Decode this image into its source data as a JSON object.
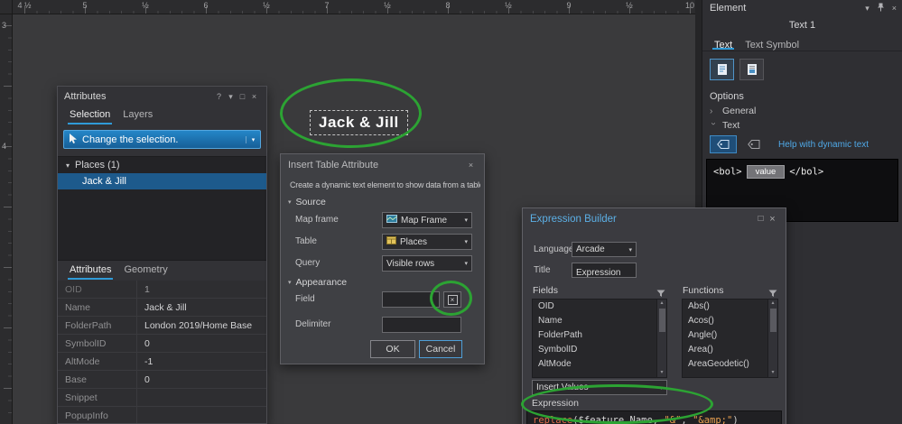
{
  "icons": {
    "close": "×",
    "dropdown": "▾",
    "help": "?",
    "float_window": "□",
    "maximize": "□",
    "chevron": "›",
    "scroll_up": "▴",
    "scroll_down": "▾",
    "tree_expander": "▾",
    "x_mark": "×",
    "section_chevron": "▾"
  },
  "rulers": {
    "horizontal": [
      "4 ½",
      "5",
      "½",
      "6",
      "½",
      "7",
      "½",
      "8",
      "½",
      "9",
      "½",
      "10"
    ],
    "vertical": [
      "3",
      "4"
    ]
  },
  "canvas": {
    "text_element": "Jack & Jill"
  },
  "attributes_panel": {
    "title": "Attributes",
    "tabs": {
      "selection": "Selection",
      "layers": "Layers"
    },
    "selection_button_label": "Change the selection.",
    "tree_parent": "Places (1)",
    "tree_child": "Jack & Jill",
    "bottom_tabs": {
      "attributes": "Attributes",
      "geometry": "Geometry"
    },
    "table_rows": [
      {
        "label": "OID",
        "value": "1"
      },
      {
        "label": "Name",
        "value": "Jack & Jill"
      },
      {
        "label": "FolderPath",
        "value": "London 2019/Home Base"
      },
      {
        "label": "SymbolID",
        "value": "0"
      },
      {
        "label": "AltMode",
        "value": "-1"
      },
      {
        "label": "Base",
        "value": "0"
      },
      {
        "label": "Snippet",
        "value": ""
      },
      {
        "label": "PopupInfo",
        "value": ""
      }
    ]
  },
  "insert_dialog": {
    "title": "Insert Table Attribute",
    "description": "Create a dynamic text element to show data from a table.",
    "source_section": "Source",
    "map_frame_label": "Map frame",
    "map_frame_value": "Map Frame",
    "table_label": "Table",
    "table_value": "Places",
    "query_label": "Query",
    "query_value": "Visible rows",
    "appearance_section": "Appearance",
    "field_label": "Field",
    "field_value": "",
    "delimiter_label": "Delimiter",
    "delimiter_value": "",
    "ok_label": "OK",
    "cancel_label": "Cancel"
  },
  "expression_builder": {
    "title": "Expression Builder",
    "language_label": "Language",
    "language_value": "Arcade",
    "title_label": "Title",
    "title_value": "Expression",
    "fields_header": "Fields",
    "functions_header": "Functions",
    "fields": [
      "OID",
      "Name",
      "FolderPath",
      "SymbolID",
      "AltMode"
    ],
    "functions": [
      "Abs()",
      "Acos()",
      "Angle()",
      "Area()",
      "AreaGeodetic()"
    ],
    "insert_values_label": "Insert Values",
    "expression_label": "Expression",
    "expression_tokens": [
      {
        "text": "replace",
        "type": "function"
      },
      {
        "text": "(",
        "type": "punctuation"
      },
      {
        "text": "$feature",
        "type": "variable"
      },
      {
        "text": ".Name",
        "type": "property"
      },
      {
        "text": ", ",
        "type": "punctuation"
      },
      {
        "text": "\"&\"",
        "type": "string"
      },
      {
        "text": ", ",
        "type": "punctuation"
      },
      {
        "text": "\"&amp;\"",
        "type": "string"
      },
      {
        "text": ")",
        "type": "punctuation"
      }
    ]
  },
  "element_panel": {
    "title": "Element",
    "element_name": "Text 1",
    "tabs": {
      "text": "Text",
      "text_symbol": "Text Symbol"
    },
    "options_label": "Options",
    "general_section": "General",
    "text_section": "Text",
    "help_link": "Help with dynamic text",
    "code_open_tag": "<bol>",
    "code_value": "value",
    "code_close_tag": "</bol>"
  },
  "colors": {
    "accent_blue": "#2f9bd8",
    "selection_blue": "#1d5a8c",
    "annotation_green": "#2ca333",
    "link_blue": "#4fa9e8",
    "dialog_title_blue": "#5cb0e6"
  }
}
